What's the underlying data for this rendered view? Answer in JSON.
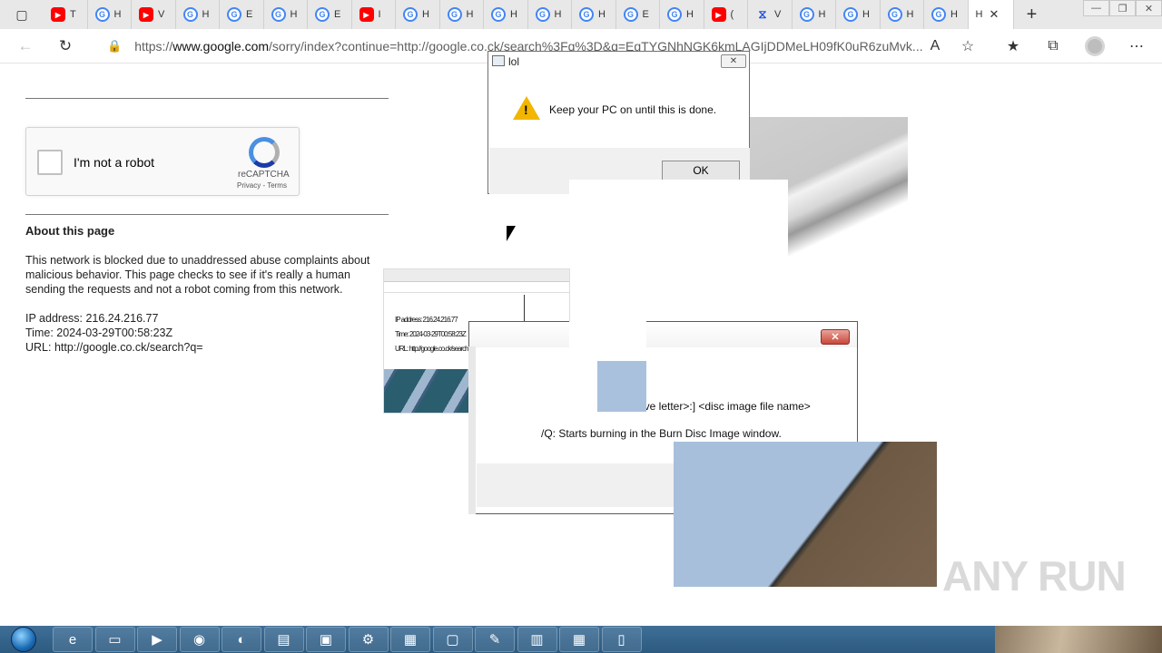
{
  "browser": {
    "tabs": [
      {
        "icon": "yt",
        "glyph": "▶",
        "label": "T"
      },
      {
        "icon": "g",
        "glyph": "G",
        "label": "H"
      },
      {
        "icon": "yt",
        "glyph": "▶",
        "label": "V"
      },
      {
        "icon": "g",
        "glyph": "G",
        "label": "H"
      },
      {
        "icon": "g",
        "glyph": "G",
        "label": "E"
      },
      {
        "icon": "g",
        "glyph": "G",
        "label": "H"
      },
      {
        "icon": "g",
        "glyph": "G",
        "label": "E"
      },
      {
        "icon": "yt",
        "glyph": "▶",
        "label": "I"
      },
      {
        "icon": "g",
        "glyph": "G",
        "label": "H"
      },
      {
        "icon": "g",
        "glyph": "G",
        "label": "H"
      },
      {
        "icon": "g",
        "glyph": "G",
        "label": "H"
      },
      {
        "icon": "g",
        "glyph": "G",
        "label": "H"
      },
      {
        "icon": "g",
        "glyph": "G",
        "label": "H"
      },
      {
        "icon": "g",
        "glyph": "G",
        "label": "E"
      },
      {
        "icon": "g",
        "glyph": "G",
        "label": "H"
      },
      {
        "icon": "yt",
        "glyph": "▶",
        "label": "("
      },
      {
        "icon": "ms",
        "glyph": "⧖",
        "label": "V"
      },
      {
        "icon": "g",
        "glyph": "G",
        "label": "H"
      },
      {
        "icon": "g",
        "glyph": "G",
        "label": "H"
      },
      {
        "icon": "g",
        "glyph": "G",
        "label": "H"
      },
      {
        "icon": "g",
        "glyph": "G",
        "label": "H"
      }
    ],
    "active_tab_label": "H",
    "url_prefix": "https://",
    "url_host": "www.google.com",
    "url_rest": "/sorry/index?continue=http://google.co.ck/search%3Fq%3D&q=EgTYGNhNGK6kmLAGIjDDMeLH09fK0uR6zuMvk..."
  },
  "page": {
    "checkbox_label": "I'm not a robot",
    "recaptcha_name": "reCAPTCHA",
    "recaptcha_terms": "Privacy - Terms",
    "about_heading": "About this page",
    "about_text": "This network is blocked due to unaddressed abuse complaints about malicious behavior. This page checks to see if it's really a human sending the requests and not a robot coming from this network.",
    "ip_line": "IP address: 216.24.216.77",
    "time_line": "Time: 2024-03-29T00:58:23Z",
    "url_line": "URL: http://google.co.ck/search?q="
  },
  "dialog": {
    "title": "lol",
    "message": "Keep your PC on until this is done.",
    "ok_label": "OK"
  },
  "dialog2": {
    "line1": "ive letter>:] <disc image file name>",
    "line2": "/Q: Starts burning in the Burn Disc Image window."
  },
  "glitch_fragments": {
    "small_shot_text": "until this",
    "tiny_ip": "IP address: 216.24.216.77",
    "tiny_time": "Time: 2024-03-29T00:58:23Z",
    "tiny_url": "URL: http://google.co.ck/search?"
  },
  "watermark": "ANY RUN",
  "taskbar": {
    "items": [
      "ie-icon",
      "folder-icon",
      "media-icon",
      "chrome-icon",
      "edge-icon",
      "notepad-icon",
      "terminal-icon",
      "tool-icon",
      "briefcase-icon",
      "monitor-icon",
      "app-icon",
      "document-icon",
      "calculator-icon",
      "file-icon"
    ]
  }
}
